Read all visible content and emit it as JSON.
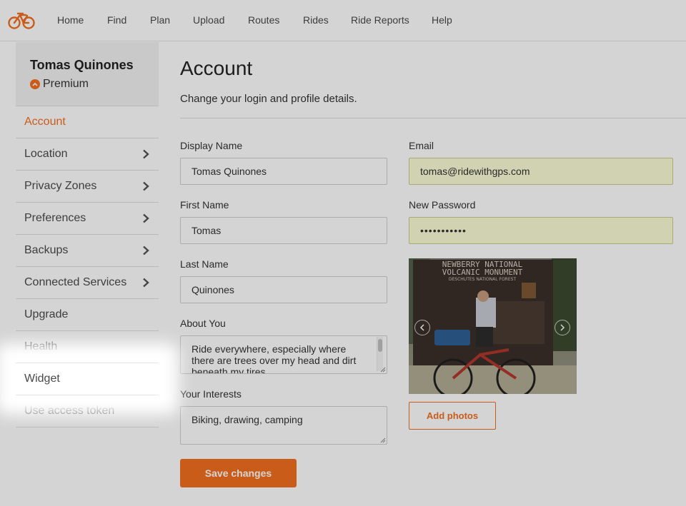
{
  "nav": {
    "items": [
      "Home",
      "Find",
      "Plan",
      "Upload",
      "Routes",
      "Rides",
      "Ride Reports",
      "Help"
    ]
  },
  "sidebar": {
    "user_name": "Tomas Quinones",
    "plan": "Premium",
    "items": [
      {
        "label": "Account",
        "active": true,
        "chevron": false
      },
      {
        "label": "Location",
        "active": false,
        "chevron": true
      },
      {
        "label": "Privacy Zones",
        "active": false,
        "chevron": true
      },
      {
        "label": "Preferences",
        "active": false,
        "chevron": true
      },
      {
        "label": "Backups",
        "active": false,
        "chevron": true
      },
      {
        "label": "Connected Services",
        "active": false,
        "chevron": true
      },
      {
        "label": "Upgrade",
        "active": false,
        "chevron": false
      },
      {
        "label": "Health",
        "active": false,
        "chevron": false
      },
      {
        "label": "Widget",
        "active": false,
        "chevron": false,
        "highlighted": true
      },
      {
        "label": "Use access token",
        "active": false,
        "chevron": false
      }
    ]
  },
  "main": {
    "title": "Account",
    "subtitle": "Change your login and profile details."
  },
  "form": {
    "display_name": {
      "label": "Display Name",
      "value": "Tomas Quinones"
    },
    "first_name": {
      "label": "First Name",
      "value": "Tomas"
    },
    "last_name": {
      "label": "Last Name",
      "value": "Quinones"
    },
    "about": {
      "label": "About You",
      "value": "Ride everywhere, especially where there are trees over my head and dirt beneath my tires."
    },
    "interests": {
      "label": "Your Interests",
      "value": "Biking, drawing, camping"
    },
    "email": {
      "label": "Email",
      "value": "tomas@ridewithgps.com"
    },
    "password": {
      "label": "New Password",
      "value": "•••••••••••"
    }
  },
  "photo": {
    "sign_line1": "NEWBERRY NATIONAL",
    "sign_line2": "VOLCANIC MONUMENT",
    "sign_line3": "DESCHUTES NATIONAL FOREST"
  },
  "buttons": {
    "add_photos": "Add photos",
    "save": "Save changes"
  },
  "colors": {
    "accent": "#f36f20",
    "autofill": "#fafdd6"
  }
}
